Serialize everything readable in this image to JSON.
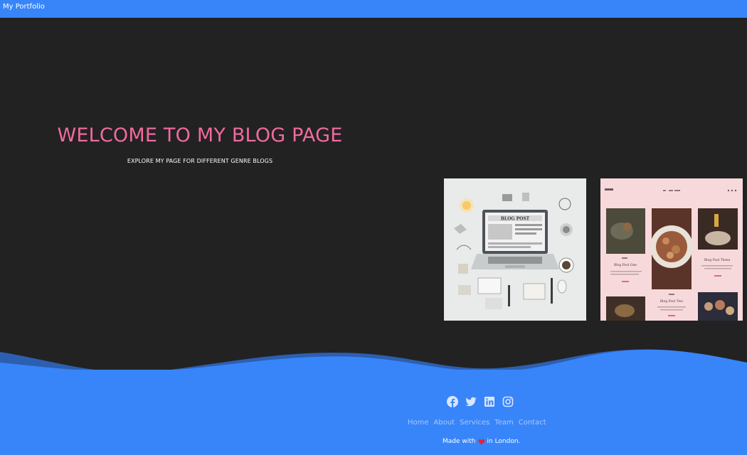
{
  "nav": {
    "brand": "My Portfolio"
  },
  "hero": {
    "title": "WELCOME TO MY BLOG PAGE",
    "subtitle": "EXPLORE MY PAGE FOR DIFFERENT GENRE BLOGS"
  },
  "thumbnails": [
    {
      "label": "BLOG POST"
    },
    {
      "label": "Blog Post One",
      "label2": "Blog Post Two",
      "label3": "Blog Post Three"
    }
  ],
  "footer": {
    "social": [
      "facebook-icon",
      "twitter-icon",
      "linkedin-icon",
      "instagram-icon"
    ],
    "links": [
      "Home",
      "About",
      "Services",
      "Team",
      "Contact"
    ],
    "made_prefix": "Made with",
    "made_suffix": "in London."
  },
  "colors": {
    "brand_blue": "#3885fa",
    "hero_bg": "#222222",
    "title_pink": "#f06a9f",
    "heart_red": "#e0243a"
  }
}
